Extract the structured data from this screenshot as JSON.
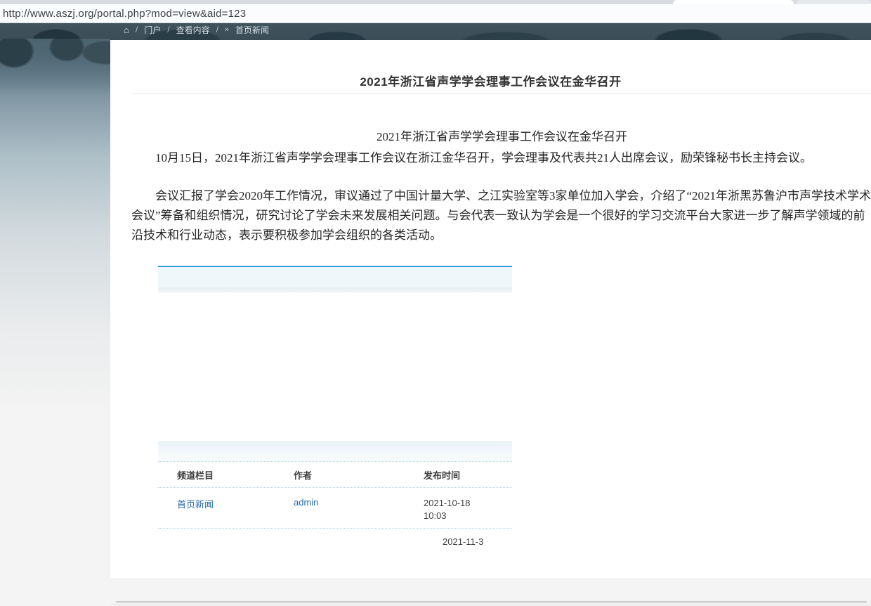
{
  "browser": {
    "url": "http://www.aszj.org/portal.php?mod=view&aid=123"
  },
  "breadcrumb": {
    "items": [
      "门户",
      "查看内容",
      "首页新闻"
    ],
    "separator": "/"
  },
  "article": {
    "title": "2021年浙江省声学学会理事工作会议在金华召开",
    "body_heading": "2021年浙江省声学学会理事工作会议在金华召开",
    "paragraph1": "10月15日，2021年浙江省声学学会理事工作会议在浙江金华召开，学会理事及代表共21人出席会议，励荣锋秘书长主持会议。",
    "paragraph2": "会议汇报了学会2020年工作情况，审议通过了中国计量大学、之江实验室等3家单位加入学会，介绍了“2021年浙黑苏鲁沪市声学技术学术会议”筹备和组织情况，研究讨论了学会未来发展相关问题。与会代表一致认为学会是一个很好的学习交流平台大家进一步了解声学领域的前沿技术和行业动态，表示要积极参加学会组织的各类活动。"
  },
  "info_table": {
    "headers": {
      "channel": "频道栏目",
      "author": "作者",
      "time": "发布时间"
    },
    "rows": [
      {
        "channel": "首页新闻",
        "author": "admin",
        "date_line1": "2021-10-18",
        "date_line2": "10:03"
      },
      {
        "channel": "",
        "author": "",
        "date_line1": "2021-11-3",
        "date_line2": ""
      }
    ]
  },
  "colors": {
    "link_blue": "#2568a9",
    "accent_blue_line": "#2aa0d8",
    "band_blue": "#ebf4fa"
  }
}
